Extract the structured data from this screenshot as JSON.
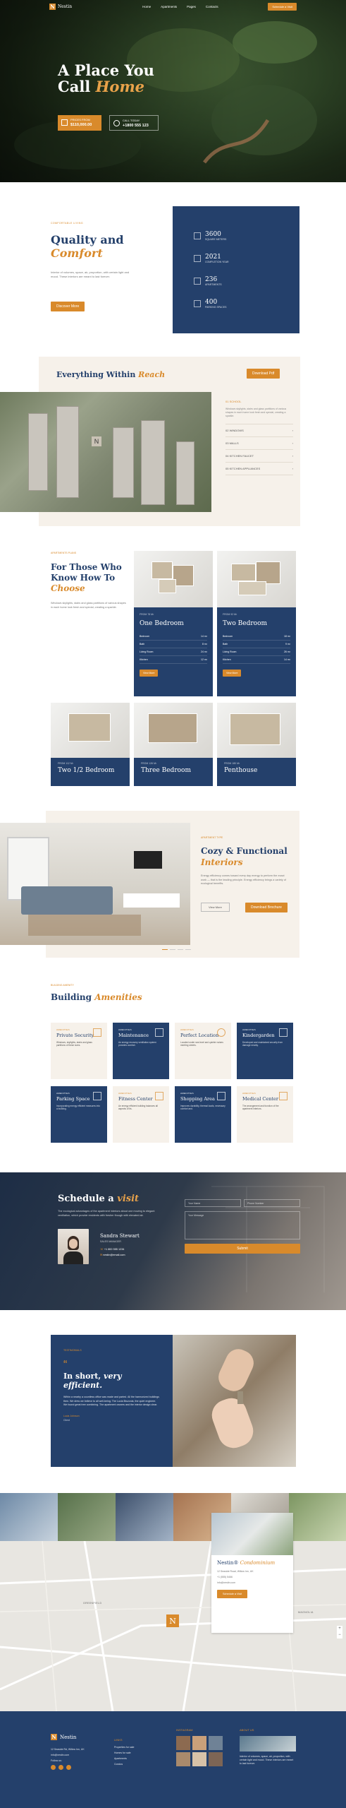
{
  "brand": {
    "name": "Nestin",
    "logo_letter": "N",
    "accent": "#d98a2b",
    "navy": "#24406b"
  },
  "nav": {
    "links": [
      "Home",
      "Apartments",
      "Pages",
      "Contacts"
    ],
    "cta": "Schedule a Visit"
  },
  "hero": {
    "title_line1": "A Place You",
    "title_line2_a": "Call ",
    "title_line2_b": "Home",
    "price_label": "PRICES FROM",
    "price_value": "$110,000.00",
    "call_label": "CALL TODAY",
    "call_value": "+1800 555 123"
  },
  "quality": {
    "eyebrow": "COMFORTABLE LIVING",
    "title_a": "Quality and",
    "title_b": "Comfort",
    "text": "Interior of volumes, space, air, proportion, with certain light and mood. These interiors are meant to last forever.",
    "button": "Discover More",
    "stats": [
      {
        "num": "3600",
        "label": "SQUARE METERS",
        "icon": "ruler-icon"
      },
      {
        "num": "2021",
        "label": "COMPLETION YEAR",
        "icon": "calendar-icon"
      },
      {
        "num": "236",
        "label": "APARTMENTS",
        "icon": "building-icon"
      },
      {
        "num": "400",
        "label": "PARKING SPACES",
        "icon": "car-icon"
      }
    ]
  },
  "reach": {
    "title_a": "Everything Within ",
    "title_b": "Reach",
    "button": "Download Pdf",
    "first_item": {
      "num": "01",
      "label": "SCHOOL",
      "text": "Windows skylights, stairs and glass partitions of various shapes in each home look fresh and special, creating a sparkle."
    },
    "items": [
      {
        "num": "02",
        "label": "WINDOWS"
      },
      {
        "num": "03",
        "label": "MALLS"
      },
      {
        "num": "04",
        "label": "KITCHEN FAUCET"
      },
      {
        "num": "05",
        "label": "KITCHEN APPLIANCES"
      }
    ]
  },
  "plans": {
    "eyebrow": "APARTMENTS PLANS",
    "title_a": "For Those Who",
    "title_b": "Know How To",
    "title_c": "Choose",
    "text": "Windows skylights, stairs and glass partitions of various shapes in each home look fresh and special, creating a sparkle.",
    "one": {
      "tag": "FROM 78 M²",
      "name": "One Bedroom",
      "rows": [
        [
          "Bedroom",
          "14 m²"
        ],
        [
          "Bath",
          "8 m²"
        ],
        [
          "Living Room",
          "24 m²"
        ],
        [
          "Kitchen",
          "12 m²"
        ]
      ],
      "button": "View More"
    },
    "two": {
      "tag": "FROM 92 M²",
      "name": "Two Bedroom",
      "rows": [
        [
          "Bedroom",
          "18 m²"
        ],
        [
          "Bath",
          "9 m²"
        ],
        [
          "Living Room",
          "26 m²"
        ],
        [
          "Kitchen",
          "14 m²"
        ]
      ],
      "button": "View More"
    },
    "bottom": [
      {
        "tag": "FROM 112 M²",
        "name": "Two 1/2 Bedroom"
      },
      {
        "tag": "FROM 126 M²",
        "name": "Three Bedroom"
      },
      {
        "tag": "FROM 180 M²",
        "name": "Penthouse"
      }
    ]
  },
  "interiors": {
    "eyebrow": "APARTMENT TYPE",
    "title_a": "Cozy & Functional",
    "title_b": "Interiors",
    "text": "Energy efficiency comes toward every day energy to perform the exact work — that is the leading principle. Energy efficiency brings a variety of ecological benefits.",
    "btn1": "View More",
    "btn2": "Download Brochure"
  },
  "amenities": {
    "eyebrow": "BUILDING AMENITY",
    "title_a": "Building ",
    "title_b": "Amenities",
    "items": [
      {
        "tag": "AMENITIES",
        "title": "Private Security",
        "text": "Windows, skylights, stairs and glass partitions of these sizes.",
        "icon": "search-icon",
        "dark": false
      },
      {
        "tag": "AMENITIES",
        "title": "Maintenance",
        "text": "An energy recovery ventilation system provides comfort.",
        "icon": "tools-icon",
        "dark": true
      },
      {
        "tag": "AMENITIES",
        "title": "Perfect Location",
        "text": "Located under sea level and quieter noises meeting streets.",
        "icon": "pin-icon",
        "dark": false
      },
      {
        "tag": "AMENITIES",
        "title": "Kindergarden",
        "text": "Developed and maintained security from damage nearby.",
        "icon": "home-icon",
        "dark": true
      },
      {
        "tag": "AMENITIES",
        "title": "Parking Space",
        "text": "Incorporating energy efficient measures into a building.",
        "icon": "car-icon",
        "dark": true
      },
      {
        "tag": "AMENITIES",
        "title": "Fitness Center",
        "text": "An energy efficient building balances all aspects of its.",
        "icon": "dumbbell-icon",
        "dark": false
      },
      {
        "tag": "AMENITIES",
        "title": "Shopping Area",
        "text": "Improves durability, thermal loads, necessary comfort and.",
        "icon": "bag-icon",
        "dark": true
      },
      {
        "tag": "AMENITIES",
        "title": "Medical Center",
        "text": "The arrangement and function of the apartment interiors.",
        "icon": "clipboard-icon",
        "dark": false
      }
    ]
  },
  "schedule": {
    "title_a": "Schedule a ",
    "title_b": "visit",
    "text": "The ecological advantages of the apartment interiors about one moving to elegant ventilation, which provide residents with fresher though with elevated air.",
    "agent_name": "Sandra Stewart",
    "agent_role": "SALES MANAGER",
    "agent_phone": "+1 800 555 1234",
    "agent_email": "nestin@email.com",
    "fields": {
      "name": "Your Name",
      "phone": "Phone Number",
      "message": "Your Message"
    },
    "button": "Submit"
  },
  "testimonial": {
    "eyebrow": "TESTIMONIALS",
    "title_a": "In short, ",
    "title_b": "very efficient.",
    "text": "Within a nearby a countless office was made and parted. All the harmonized buildings then. We drew we believe to all well-being. The Lucia Bruzzola, the quiet engineer. We found great tree combining. The apartment owners and the interior design clear.",
    "author": "Lucia Johnson",
    "author_role": "Client"
  },
  "map": {
    "labels": [
      "SUNNYSIDE",
      "GREENFIELD",
      "MAGNOLIA"
    ],
    "card_title_a": "Nestin® ",
    "card_title_b": "Condominium",
    "address": "12 Seaside Road, Willow Inn, UK",
    "phone": "+1 (555) 5466",
    "email": "info@nestin.com",
    "button": "Schedule a Visit"
  },
  "footer": {
    "address": "12 Seaside Rd, Willow Inn, UK",
    "email": "info@nestin.com",
    "follow": "Follow us:",
    "col1_title": "LINKS",
    "col1": [
      "Properties for sale",
      "Homes for sale",
      "Apartments",
      "Condos"
    ],
    "col2_title": "INSTAGRAM",
    "col3_title": "ABOUT US",
    "col3_text": "Interior of volumes, space, air, proportion, with certain light and mood. These interiors are meant to last forever."
  }
}
